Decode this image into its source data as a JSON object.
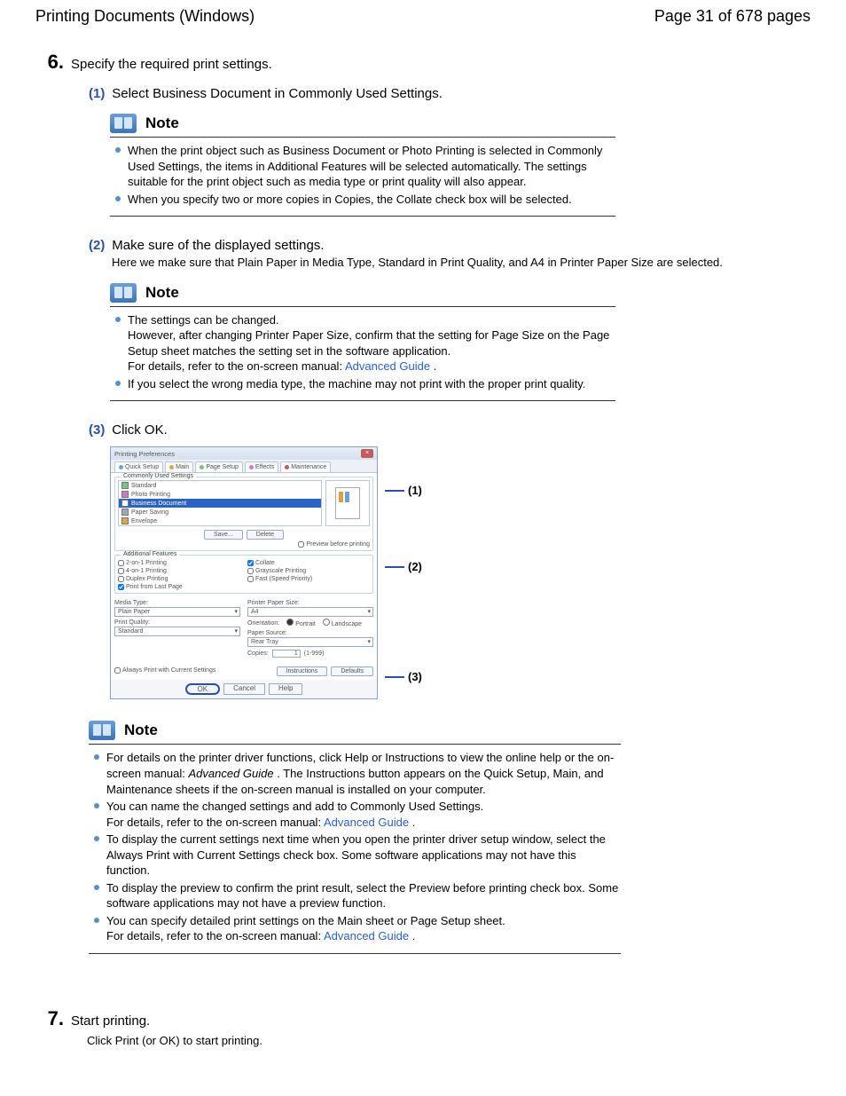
{
  "header": {
    "title": "Printing Documents (Windows)",
    "page_indicator": "Page 31 of 678 pages"
  },
  "step6": {
    "num": "6.",
    "text": "Specify the required print settings."
  },
  "sub1": {
    "label": "(1)",
    "title": "Select Business Document in Commonly Used Settings."
  },
  "note1": {
    "title": "Note",
    "items": [
      "When the print object such as Business Document or Photo Printing is selected in Commonly Used Settings, the items in Additional Features will be selected automatically. The settings suitable for the print object such as media type or print quality will also appear.",
      "When you specify two or more copies in Copies, the Collate check box will be selected."
    ]
  },
  "sub2": {
    "label": "(2)",
    "title": "Make sure of the displayed settings.",
    "body": "Here we make sure that Plain Paper in Media Type, Standard in Print Quality, and A4 in Printer Paper Size are selected."
  },
  "note2": {
    "title": "Note",
    "item1a": "The settings can be changed.",
    "item1b": "However, after changing Printer Paper Size, confirm that the setting for Page Size on the Page Setup sheet matches the setting set in the software application.",
    "item1c_prefix": "For details, refer to the on-screen manual: ",
    "item1c_link": "Advanced Guide",
    "item1c_suffix": " .",
    "item2": "If you select the wrong media type, the machine may not print with the proper print quality."
  },
  "sub3": {
    "label": "(3)",
    "title": "Click OK."
  },
  "dialog": {
    "title": "Printing Preferences",
    "tabs": {
      "quick": "Quick Setup",
      "main": "Main",
      "page": "Page Setup",
      "effects": "Effects",
      "maint": "Maintenance"
    },
    "cus_title": "Commonly Used Settings",
    "cus_items": {
      "standard": "Standard",
      "photo": "Photo Printing",
      "business": "Business Document",
      "paper_saving": "Paper Saving",
      "envelope": "Envelope"
    },
    "save_btn": "Save...",
    "delete_btn": "Delete",
    "preview_chk": "Preview before printing",
    "af_title": "Additional Features",
    "af_items": {
      "two_on_one": "2-on-1 Printing",
      "four_on_one": "4-on-1 Printing",
      "duplex": "Duplex Printing",
      "last_page": "Print from Last Page",
      "collate": "Collate",
      "grayscale": "Grayscale Printing",
      "fast": "Fast (Speed Priority)"
    },
    "media_lbl": "Media Type:",
    "media_val": "Plain Paper",
    "quality_lbl": "Print Quality:",
    "quality_val": "Standard",
    "pps_lbl": "Printer Paper Size:",
    "pps_val": "A4",
    "orient_lbl": "Orientation:",
    "orient_portrait": "Portrait",
    "orient_landscape": "Landscape",
    "source_lbl": "Paper Source:",
    "source_val": "Rear Tray",
    "copies_lbl": "Copies:",
    "copies_val": "1",
    "copies_range": "(1-999)",
    "always_chk": "Always Print with Current Settings",
    "instructions_btn": "Instructions",
    "defaults_btn": "Defaults",
    "ok_btn": "OK",
    "cancel_btn": "Cancel",
    "help_btn": "Help"
  },
  "callouts": {
    "c1": "(1)",
    "c2": "(2)",
    "c3": "(3)"
  },
  "note3": {
    "title": "Note",
    "i1a": "For details on the printer driver functions, click Help or Instructions to view the online help or the on-screen manual: ",
    "i1b_italic": "Advanced Guide",
    "i1c": " . The Instructions button appears on the Quick Setup, Main, and Maintenance sheets if the on-screen manual is installed on your computer.",
    "i2a": "You can name the changed settings and add to Commonly Used Settings.",
    "i2b_prefix": "For details, refer to the on-screen manual: ",
    "i2b_link": "Advanced Guide",
    "i2b_suffix": " .",
    "i3": "To display the current settings next time when you open the printer driver setup window, select the Always Print with Current Settings check box. Some software applications may not have this function.",
    "i4": "To display the preview to confirm the print result, select the Preview before printing check box. Some software applications may not have a preview function.",
    "i5a": "You can specify detailed print settings on the Main sheet or Page Setup sheet.",
    "i5b_prefix": "For details, refer to the on-screen manual: ",
    "i5b_link": "Advanced Guide",
    "i5b_suffix": " ."
  },
  "step7": {
    "num": "7.",
    "text": "Start printing.",
    "body": "Click Print (or OK) to start printing."
  }
}
